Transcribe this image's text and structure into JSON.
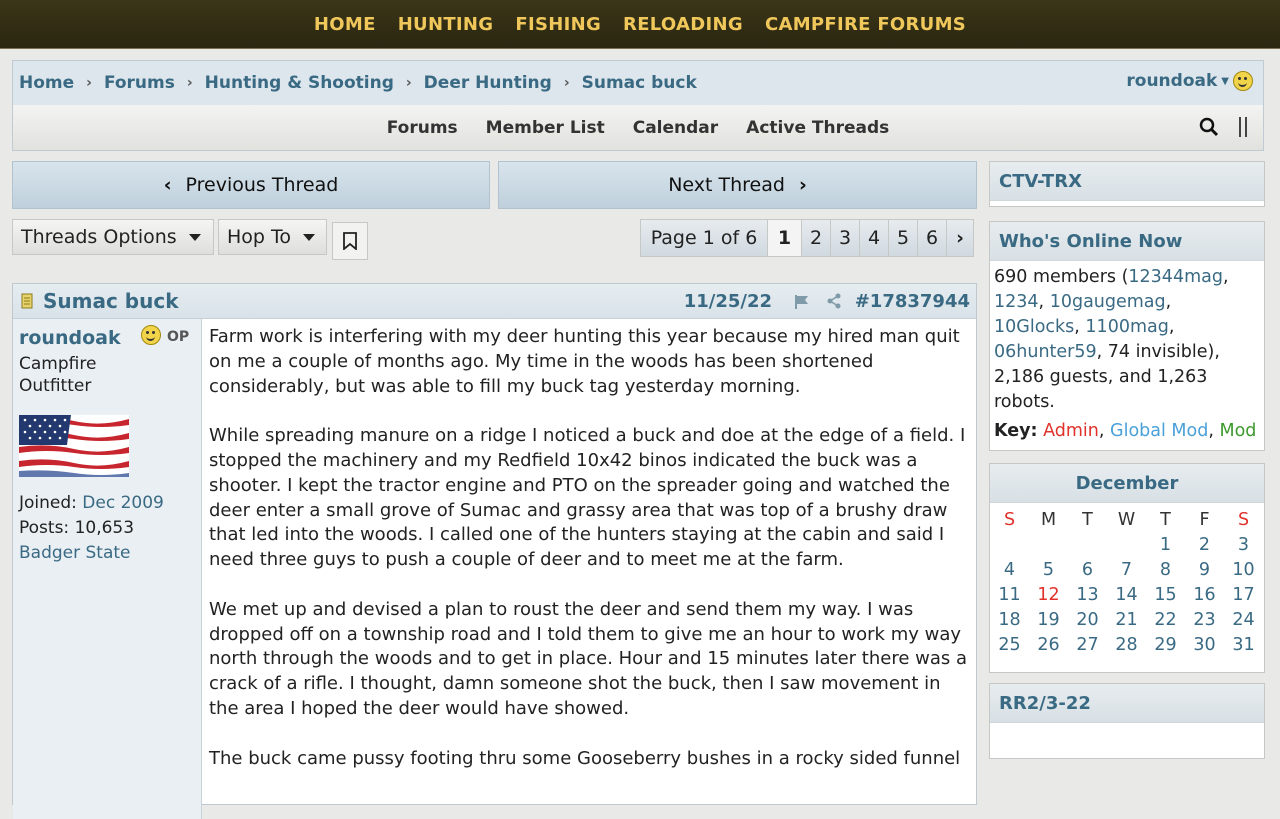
{
  "topnav": [
    "HOME",
    "HUNTING",
    "FISHING",
    "RELOADING",
    "CAMPFIRE FORUMS"
  ],
  "breadcrumb": [
    "Home",
    "Forums",
    "Hunting & Shooting",
    "Deer Hunting",
    "Sumac buck"
  ],
  "user": {
    "name": "roundoak"
  },
  "menu": [
    "Forums",
    "Member List",
    "Calendar",
    "Active Threads"
  ],
  "nav": {
    "prev": "Previous Thread",
    "next": "Next Thread"
  },
  "controls": {
    "threads_options": "Threads Options",
    "hop_to": "Hop To"
  },
  "pager": {
    "label": "Page 1 of 6",
    "pages": [
      "1",
      "2",
      "3",
      "4",
      "5",
      "6"
    ],
    "current": "1"
  },
  "post": {
    "title": "Sumac buck",
    "date": "11/25/22",
    "number": "#17837944",
    "author": {
      "name": "roundoak",
      "op": "OP",
      "title_line1": "Campfire",
      "title_line2": "Outfitter",
      "joined_label": "Joined:",
      "joined_value": "Dec 2009",
      "posts_label": "Posts:",
      "posts_value": "10,653",
      "location": "Badger State"
    },
    "paragraphs": [
      "Farm work is interfering with my deer hunting this year because my hired man quit on me a couple of months ago. My time in the woods has been shortened considerably, but was able to fill my buck tag yesterday morning.",
      "While spreading manure on a ridge I noticed a buck and doe at the edge of a field. I stopped the machinery and my Redfield 10x42 binos indicated the buck was a shooter. I kept the tractor engine and PTO on the spreader going and watched the deer enter a small grove of Sumac and grassy area that was top of a brushy draw that led into the woods. I called one of the hunters staying at the cabin and said I need three guys to push a couple of deer and to meet me at the farm.",
      "We met up and devised a plan to roust the deer and send them my way. I was dropped off on a township road and I told them to give me an hour to work my way north through the woods and to get in place. Hour and 15 minutes later there was a crack of a rifle. I thought, damn someone shot the buck, then I saw movement in the area I hoped the deer would have showed.",
      "The buck came pussy footing thru some Gooseberry bushes in a rocky sided funnel"
    ]
  },
  "sidebar": {
    "ctv": "CTV-TRX",
    "online": {
      "title": "Who's Online Now",
      "members_count": "690 members (",
      "members": [
        "12344mag",
        "1234",
        "10gaugemag",
        "10Glocks",
        "1100mag",
        "06hunter59"
      ],
      "rest": ", 74 invisible), 2,186 guests, and 1,263 robots.",
      "key_label": "Key:",
      "key_admin": "Admin",
      "key_global": "Global Mod",
      "key_mod": "Mod",
      "colors": {
        "admin": "#e0312b",
        "global": "#4aa0d8",
        "mod": "#3c9a2c"
      }
    },
    "calendar": {
      "month": "December",
      "weekdays": [
        "S",
        "M",
        "T",
        "W",
        "T",
        "F",
        "S"
      ],
      "weeks": [
        [
          "",
          "",
          "",
          "",
          "1",
          "2",
          "3"
        ],
        [
          "4",
          "5",
          "6",
          "7",
          "8",
          "9",
          "10"
        ],
        [
          "11",
          "12",
          "13",
          "14",
          "15",
          "16",
          "17"
        ],
        [
          "18",
          "19",
          "20",
          "21",
          "22",
          "23",
          "24"
        ],
        [
          "25",
          "26",
          "27",
          "28",
          "29",
          "30",
          "31"
        ]
      ],
      "today": "12"
    },
    "rr": "RR2/3-22"
  }
}
